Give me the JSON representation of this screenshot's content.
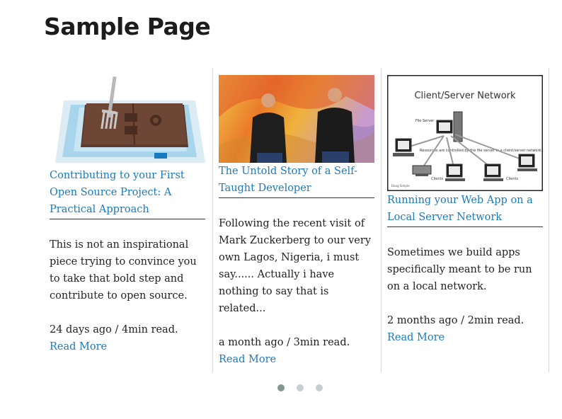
{
  "page": {
    "title": "Sample Page"
  },
  "colors": {
    "link": "#1a7abf",
    "text": "#222222",
    "divider": "#d8d8d8",
    "dot_active": "#869791",
    "dot_inactive": "#c6cfd0"
  },
  "posts": [
    {
      "image_icon": "github-sink-image",
      "title": "Contributing to your First Open Source Project: A Practical Approach",
      "excerpt": "This is not an inspirational piece trying to convince you to take that bold step and contribute to open source.",
      "meta": "24 days ago / 4min read.",
      "read_more": "Read More"
    },
    {
      "image_icon": "developers-photo",
      "title": "The Untold Story of a Self-Taught Developer",
      "excerpt": "Following the recent visit of Mark Zuckerberg to our very own Lagos, Nigeria, i must say...... Actually i have nothing to say that is related...",
      "meta": "a month ago / 3min read.",
      "read_more": "Read More"
    },
    {
      "image_icon": "client-server-diagram",
      "image_caption": "Client/Server Network",
      "diagram_labels": {
        "file_server": "File Server",
        "resources": "Resources are controlled by the file server in a client/server network.",
        "clients_left": "Clients",
        "clients_right": "Clients",
        "credit": "Doug Simple"
      },
      "title": "Running your Web App on a Local Server Network",
      "excerpt": "Sometimes we build apps specifically meant to be run on a local network.",
      "meta": "2 months ago / 2min read.",
      "read_more": "Read More"
    }
  ],
  "pagination": {
    "total": 3,
    "active": 1
  }
}
